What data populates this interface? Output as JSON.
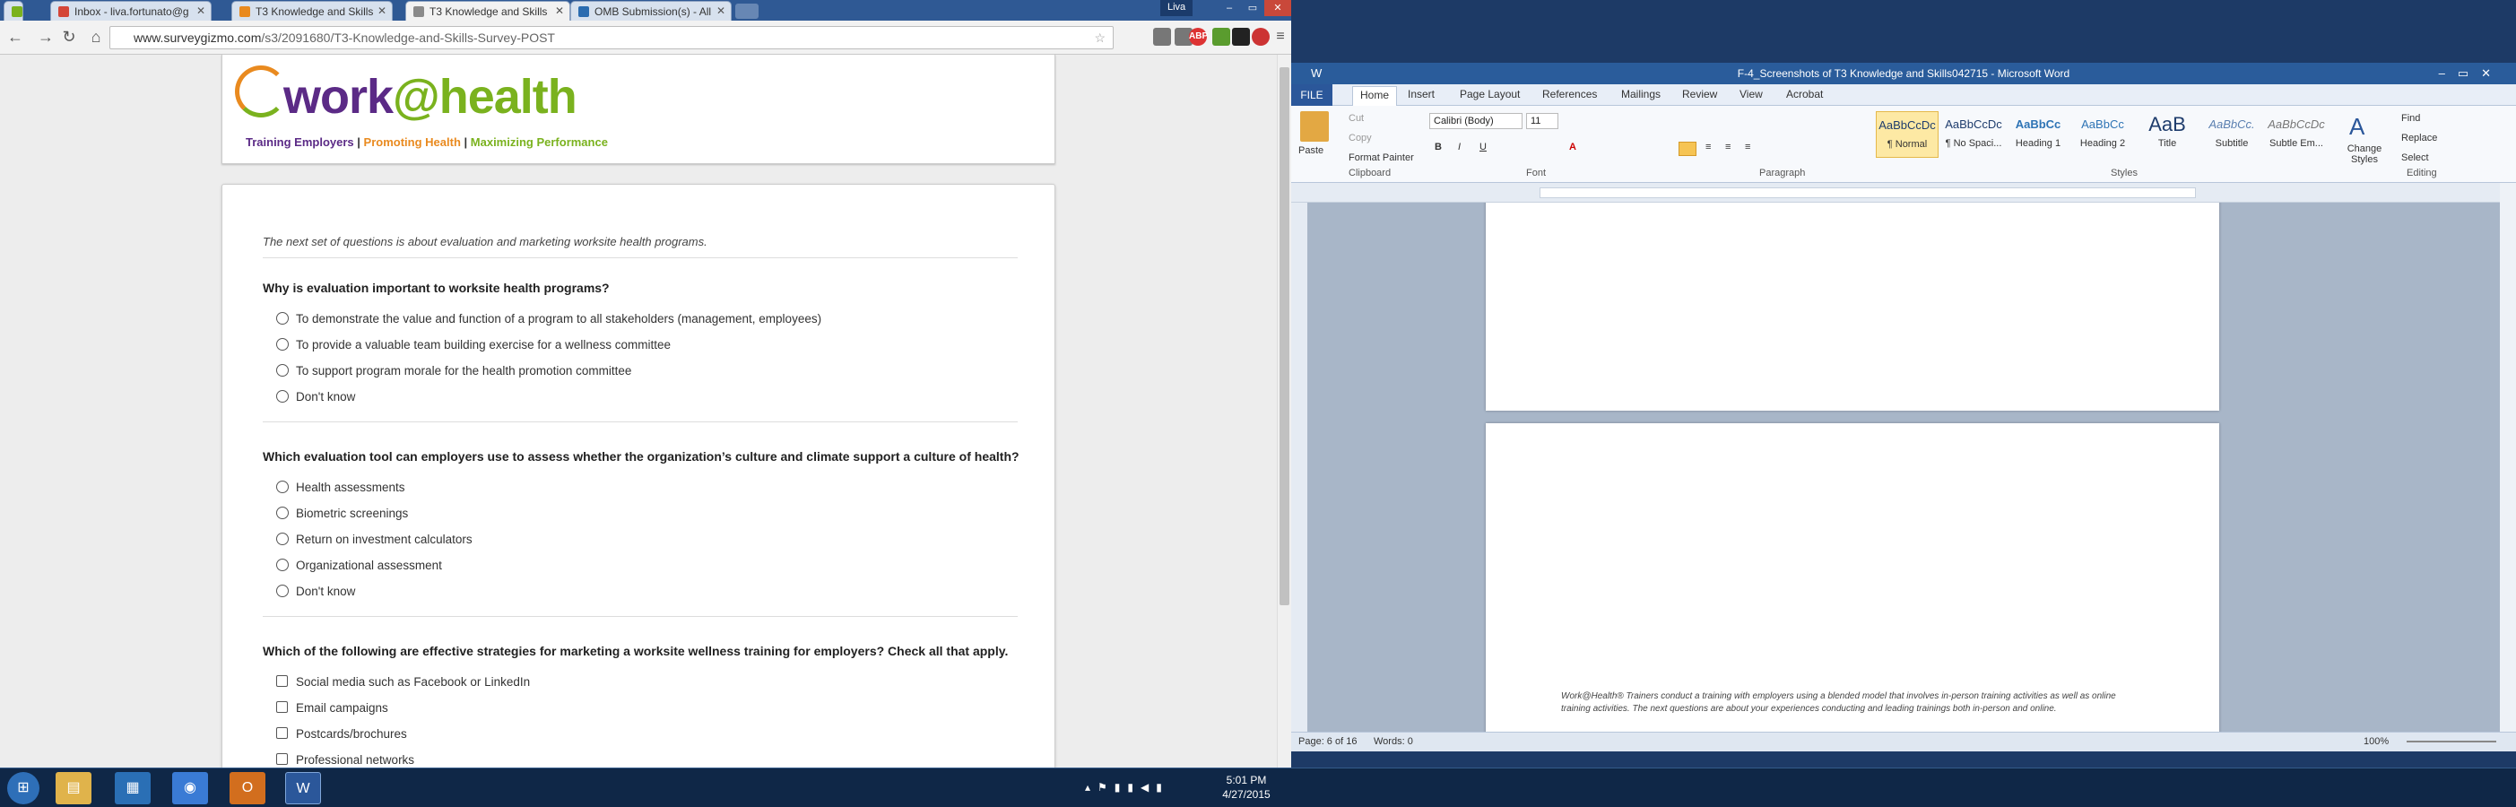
{
  "browser": {
    "tabs": [
      {
        "label": "Inbox - liva.fortunato@g",
        "color": "#d44638"
      },
      {
        "label": "T3 Knowledge and Skills",
        "color": "#e98a1f"
      },
      {
        "label": "T3 Knowledge and Skills",
        "color": "#8a8a8a"
      },
      {
        "label": "OMB Submission(s) - All",
        "color": "#2b6cb0"
      }
    ],
    "profile": "Liva",
    "url_host": "www.surveygizmo.com",
    "url_path": "/s3/2091680/T3-Knowledge-and-Skills-Survey-POST",
    "ext_abp": "ABP"
  },
  "survey": {
    "logo_prefix": "work",
    "logo_suffix": "@health",
    "tagline": [
      "Training Employers",
      "Promoting Health",
      "Maximizing Performance"
    ],
    "tagline_sep": "|",
    "intro": "The next set of questions is about evaluation and marketing worksite health programs.",
    "questions": [
      {
        "text": "Why is evaluation important to worksite health programs?",
        "options": [
          "To demonstrate the value and function of a program to all stakeholders (management, employees)",
          "To provide a valuable team building exercise for a wellness committee",
          "To support program morale for the health promotion committee",
          "Don't know"
        ]
      },
      {
        "text": "Which evaluation tool can employers use to assess whether the organization’s culture and climate support a culture of health?",
        "options": [
          "Health assessments",
          "Biometric screenings",
          "Return on investment calculators",
          "Organizational assessment",
          "Don't know"
        ]
      },
      {
        "text": "Which of the following are effective strategies for marketing a worksite wellness training for employers?  Check all that apply.",
        "options": [
          "Social media such as Facebook or LinkedIn",
          "Email campaigns",
          "Postcards/brochures",
          "Professional networks"
        ]
      }
    ]
  },
  "word": {
    "title": "F-4_Screenshots of T3 Knowledge and Skills042715 - Microsoft Word",
    "tabs": [
      "FILE",
      "Home",
      "Insert",
      "Page Layout",
      "References",
      "Mailings",
      "Review",
      "View",
      "Acrobat"
    ],
    "clipboard": {
      "paste": "Paste",
      "cut": "Cut",
      "copy": "Copy",
      "format_painter": "Format Painter",
      "label": "Clipboard"
    },
    "font": {
      "name": "Calibri (Body)",
      "size": "11",
      "label": "Font"
    },
    "paragraph_label": "Paragraph",
    "styles": [
      {
        "preview": "AaBbCcDc",
        "name": "¶ Normal"
      },
      {
        "preview": "AaBbCcDc",
        "name": "¶ No Spaci..."
      },
      {
        "preview": "AaBbCc",
        "name": "Heading 1"
      },
      {
        "preview": "AaBbCc",
        "name": "Heading 2"
      },
      {
        "preview": "AaB",
        "name": "Title"
      },
      {
        "preview": "AaBbCc.",
        "name": "Subtitle"
      },
      {
        "preview": "AaBbCcDc",
        "name": "Subtle Em..."
      }
    ],
    "styles_label": "Styles",
    "change_styles": "Change Styles",
    "editing": {
      "find": "Find",
      "replace": "Replace",
      "select": "Select",
      "label": "Editing"
    },
    "doc_text": "Work@Health® Trainers conduct a training with employers using a blended model that involves in-person training activities as well as online training activities. The next questions are about your experiences conducting and leading trainings both in-person and online.",
    "status": {
      "page": "Page: 6 of 16",
      "words": "Words: 0",
      "zoom": "100%"
    }
  },
  "taskbar": {
    "time": "5:01 PM",
    "date": "4/27/2015"
  }
}
